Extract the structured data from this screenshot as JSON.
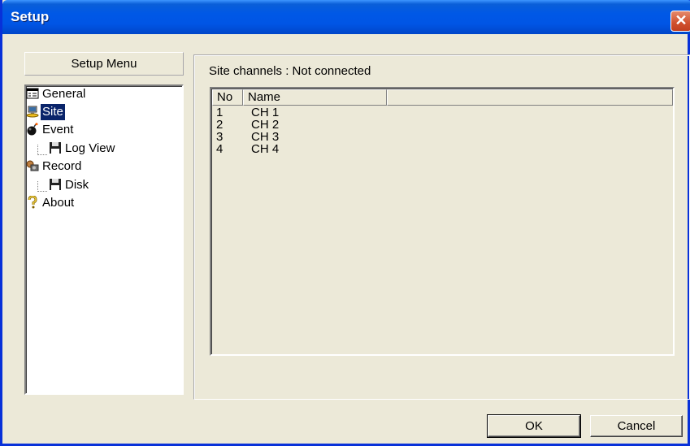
{
  "window": {
    "title": "Setup",
    "close_glyph": "✕"
  },
  "menu": {
    "header": "Setup Menu",
    "items": [
      {
        "label": "General",
        "icon": "properties-icon"
      },
      {
        "label": "Site",
        "icon": "network-computer-icon",
        "selected": true
      },
      {
        "label": "Event",
        "icon": "bomb-icon"
      },
      {
        "label": "Log View",
        "icon": "floppy-disk-icon"
      },
      {
        "label": "Record",
        "icon": "film-camera-icon"
      },
      {
        "label": "Disk",
        "icon": "floppy-disk-icon"
      },
      {
        "label": "About",
        "icon": "question-mark-icon"
      }
    ]
  },
  "site": {
    "status": "Site channels : Not connected",
    "columns": [
      "No",
      "Name"
    ],
    "rows": [
      {
        "no": "1",
        "name": "CH 1"
      },
      {
        "no": "2",
        "name": "CH 2"
      },
      {
        "no": "3",
        "name": "CH 3"
      },
      {
        "no": "4",
        "name": "CH 4"
      }
    ]
  },
  "buttons": {
    "ok": "OK",
    "cancel": "Cancel"
  }
}
